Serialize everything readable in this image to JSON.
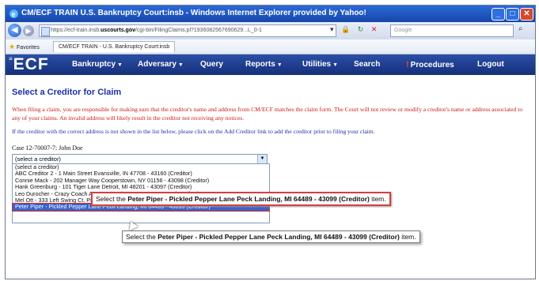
{
  "window": {
    "title": "CM/ECF TRAIN   U.S. Bankruptcy Court:insb - Windows Internet Explorer provided by Yahoo!"
  },
  "address_bar": {
    "url_prefix": "https://ecf-train.insb.",
    "url_domain": "uscourts.gov",
    "url_rest": "/cgi-bin/FilingClaims.pl?1936082567690629...L_0-1",
    "search_placeholder": "Google"
  },
  "favorites": {
    "label": "Favorites",
    "tab": "CM/ECF TRAIN - U.S. Bankruptcy Court:insb"
  },
  "menu": {
    "logo": "ECF",
    "items": [
      {
        "label": "Bankruptcy",
        "caret": "▼"
      },
      {
        "label": "Adversary",
        "caret": "▼"
      },
      {
        "label": "Query",
        "caret": ""
      },
      {
        "label": "Reports",
        "caret": "▼"
      },
      {
        "label": "Utilities",
        "caret": "▼"
      },
      {
        "label": "Search",
        "caret": ""
      },
      {
        "label": "Procedures",
        "caret": ""
      },
      {
        "label": "Logout",
        "caret": ""
      }
    ]
  },
  "page": {
    "title": "Select a Creditor for Claim",
    "warning": "When filing a claim, you are responsible for making sure that the creditor's name and address from CM/ECF matches the claim form. The Court will not review or modify a creditor's name or address associated to any of your claims. An invalid address will likely result in the creditor not receiving any notices.",
    "instruction": "If the creditor with the correct address is not shown in the list below, please click on the Add Creditor link to add the creditor prior to filing your claim.",
    "case_label": "Case 12-70007-7: John Doe",
    "select_value": "(select a creditor)",
    "options": [
      "(select a creditor)",
      "ABC Creditor 2 - 1 Main Street Evansville, IN 47708 - 43160 (Creditor)",
      "Connie Mack - 202 Manager Way Cooperstown, NY 01156 - 43098 (Creditor)",
      "Hank Greenburg - 101 Tiger Lane Detroit, MI 48201 - 43097 (Creditor)",
      "Leo Durocher - Crazy Coach Ave New York, NY 00236 - 43101 (Creditor)",
      "Mel Ott - 333 Left Swing Ct. Pittsburgh, PA 24659 - 43100 (Creditor)",
      "Peter Piper - Pickled Pepper Lane Peck Landing, MI 64489 - 43099 (Creditor)"
    ]
  },
  "callout": {
    "prefix": "Select the",
    "item": "Peter Piper - Pickled Pepper Lane Peck Landing, MI 64489 - 43099 (Creditor)",
    "suffix": "item."
  }
}
